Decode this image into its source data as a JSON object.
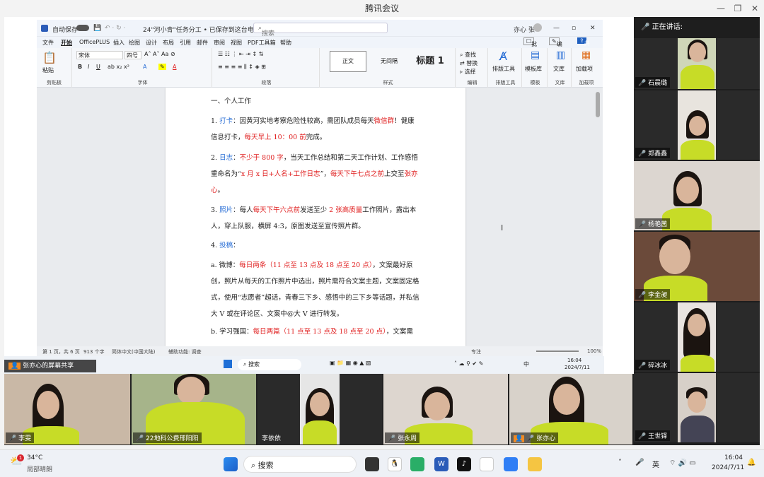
{
  "app": {
    "title": "腾讯会议"
  },
  "word": {
    "autosave": "自动保存",
    "doc_title": "24\"河小青\"任务分工 • 已保存到这台电脑 ∨",
    "search": "搜索",
    "user": "亦心 张",
    "menu": [
      "文件",
      "开始",
      "OfficePLUS",
      "插入",
      "绘图",
      "设计",
      "布局",
      "引用",
      "邮件",
      "审阅",
      "视图",
      "PDF工具箱",
      "帮助"
    ],
    "batch": "批注",
    "edit": "编辑",
    "share": "共享",
    "paste": "粘贴",
    "font_name": "宋体",
    "font_size": "四号",
    "styles": [
      "正文",
      "无间隔",
      "标题 1"
    ],
    "find": "查找",
    "replace": "替换",
    "select": "选择",
    "groups": [
      "剪贴板",
      "字体",
      "段落",
      "样式",
      "编辑",
      "排版工具",
      "模板",
      "文库",
      "加载项"
    ],
    "typeset": "排版工具",
    "template": "模板库",
    "library": "文库",
    "addin": "加载项",
    "status": {
      "page": "第 1 页，共 6 页",
      "words": "913 个字",
      "lang": "简体中文(中国大陆)",
      "access": "辅助功能: 调查",
      "focus": "专注",
      "zoom": "100%"
    }
  },
  "doc": {
    "p0": "一、个人工作",
    "p1": [
      {
        "t": "1. "
      },
      {
        "t": "打卡",
        "c": "blue"
      },
      {
        "t": "：因黄河实地考察危险性较高，需团队成员每天"
      },
      {
        "t": "微信群",
        "c": "red"
      },
      {
        "t": "！健康信息打卡，"
      },
      {
        "t": "每天早上 10：00 前",
        "c": "red"
      },
      {
        "t": "完成。"
      }
    ],
    "p2": [
      {
        "t": "2. "
      },
      {
        "t": "日志",
        "c": "blue"
      },
      {
        "t": "："
      },
      {
        "t": "不少于 800 字",
        "c": "red"
      },
      {
        "t": "，当天工作总结和第二天工作计划、工作感悟重命名为“"
      },
      {
        "t": "x 月 x 日+人名+工作日志",
        "c": "red"
      },
      {
        "t": "”，"
      },
      {
        "t": "每天下午七点之前",
        "c": "red"
      },
      {
        "t": "上交至"
      },
      {
        "t": "张亦心",
        "c": "red"
      },
      {
        "t": "。"
      }
    ],
    "p3": [
      {
        "t": "3. "
      },
      {
        "t": "照片",
        "c": "blue"
      },
      {
        "t": "：每人"
      },
      {
        "t": "每天下午六点前",
        "c": "red"
      },
      {
        "t": "发送至少 "
      },
      {
        "t": "2 张高质量",
        "c": "red"
      },
      {
        "t": "工作照片，露出本人，穿上队服，横屏 4:3，原图发送至宣传照片群。"
      }
    ],
    "p4": [
      {
        "t": "4. "
      },
      {
        "t": "投稿",
        "c": "blue"
      },
      {
        "t": "："
      }
    ],
    "p5": [
      {
        "t": "a. 微博："
      },
      {
        "t": "每日两条（11 点至 13 点及 18 点至 20 点）",
        "c": "red"
      },
      {
        "t": "，文案最好原创，照片从每天的工作照片中选出，照片需符合文案主题，文案固定格式，使用“志愿者”超话，青春三下乡、感悟中的三下乡等话题，并私信大 V 或在评论区、文案中@大 V 进行转发。"
      }
    ],
    "p6": [
      {
        "t": "b. 学习强国："
      },
      {
        "t": "每日两篇（11 点至 13 点及 18 点至 20 点）",
        "c": "red"
      },
      {
        "t": "，文案需"
      }
    ]
  },
  "inner_taskbar": {
    "search": "搜索",
    "time": "16:04",
    "date": "2024/7/11",
    "ime": "中"
  },
  "share_label": "张亦心的屏幕共享",
  "speaking": "正在讲话:",
  "side_participants": [
    "石晨璐",
    "郑鑫鑫",
    "杨艳茜",
    "李金昶",
    "碎冰冰",
    "王世铎"
  ],
  "bottom_participants": [
    "李雯",
    "22地科公费邢阳阳",
    "李依依",
    "张永周",
    "张亦心"
  ],
  "taskbar": {
    "temp": "34°C",
    "weather": "局部晴朗",
    "badge": "1",
    "search": "搜索",
    "ime": "英",
    "time": "16:04",
    "date": "2024/7/11"
  }
}
